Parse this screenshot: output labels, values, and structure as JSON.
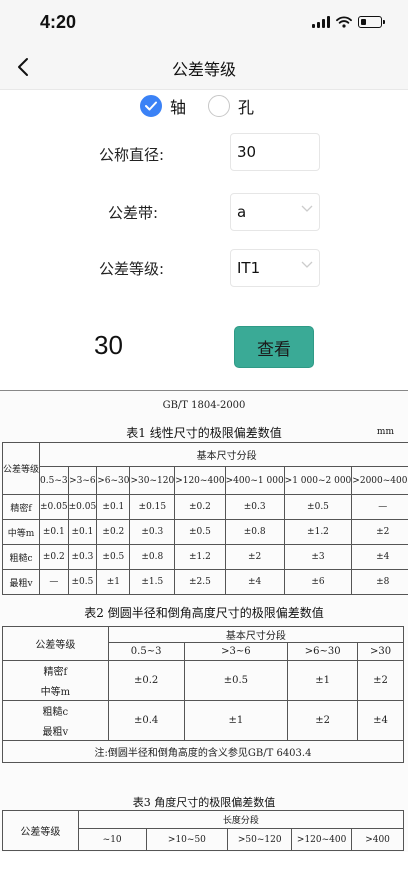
{
  "status_bar": {
    "time": "4:20"
  },
  "nav": {
    "title": "公差等级"
  },
  "form": {
    "radio_shaft": "轴",
    "radio_hole": "孔",
    "label_diameter": "公称直径:",
    "value_diameter": "30",
    "label_zone": "公差带:",
    "value_zone": "a",
    "label_grade": "公差等级:",
    "value_grade": "IT1",
    "result": "30",
    "view_button": "查看"
  },
  "doc": {
    "standard": "GB/T 1804-2000",
    "table1": {
      "title": "表1  线性尺寸的极限偏差数值",
      "unit": "mm",
      "col_header": "公差等级",
      "group_header": "基本尺寸分段",
      "ranges": [
        "0.5~3",
        ">3~6",
        ">6~30",
        ">30~120",
        ">120~400",
        ">400~1 000",
        ">1 000~2 000",
        ">2000~4000"
      ],
      "rows": [
        {
          "grade": "精密f",
          "values": [
            "±0.05",
            "±0.05",
            "±0.1",
            "±0.15",
            "±0.2",
            "±0.3",
            "±0.5",
            "—"
          ]
        },
        {
          "grade": "中等m",
          "values": [
            "±0.1",
            "±0.1",
            "±0.2",
            "±0.3",
            "±0.5",
            "±0.8",
            "±1.2",
            "±2"
          ]
        },
        {
          "grade": "粗糙c",
          "values": [
            "±0.2",
            "±0.3",
            "±0.5",
            "±0.8",
            "±1.2",
            "±2",
            "±3",
            "±4"
          ]
        },
        {
          "grade": "最粗v",
          "values": [
            "—",
            "±0.5",
            "±1",
            "±1.5",
            "±2.5",
            "±4",
            "±6",
            "±8"
          ]
        }
      ]
    },
    "table2": {
      "title": "表2  倒圆半径和倒角高度尺寸的极限偏差数值",
      "col_header": "公差等级",
      "group_header": "基本尺寸分段",
      "ranges": [
        "0.5~3",
        ">3~6",
        ">6~30",
        ">30"
      ],
      "grade_f": "精密f",
      "grade_m": "中等m",
      "grade_c": "粗糙c",
      "grade_v": "最粗v",
      "values_fm": [
        "±0.2",
        "±0.5",
        "±1",
        "±2"
      ],
      "values_cv": [
        "±0.4",
        "±1",
        "±2",
        "±4"
      ],
      "note": "注:倒圆半径和倒角高度的含义参见GB/T 6403.4"
    },
    "table3": {
      "title": "表3  角度尺寸的极限偏差数值",
      "col_header": "公差等级",
      "group_header": "长度分段",
      "ranges": [
        "~10",
        ">10~50",
        ">50~120",
        ">120~400",
        ">400"
      ]
    }
  },
  "colors": {
    "accent_blue": "#3b82f6",
    "button_teal": "#3aaa96"
  }
}
